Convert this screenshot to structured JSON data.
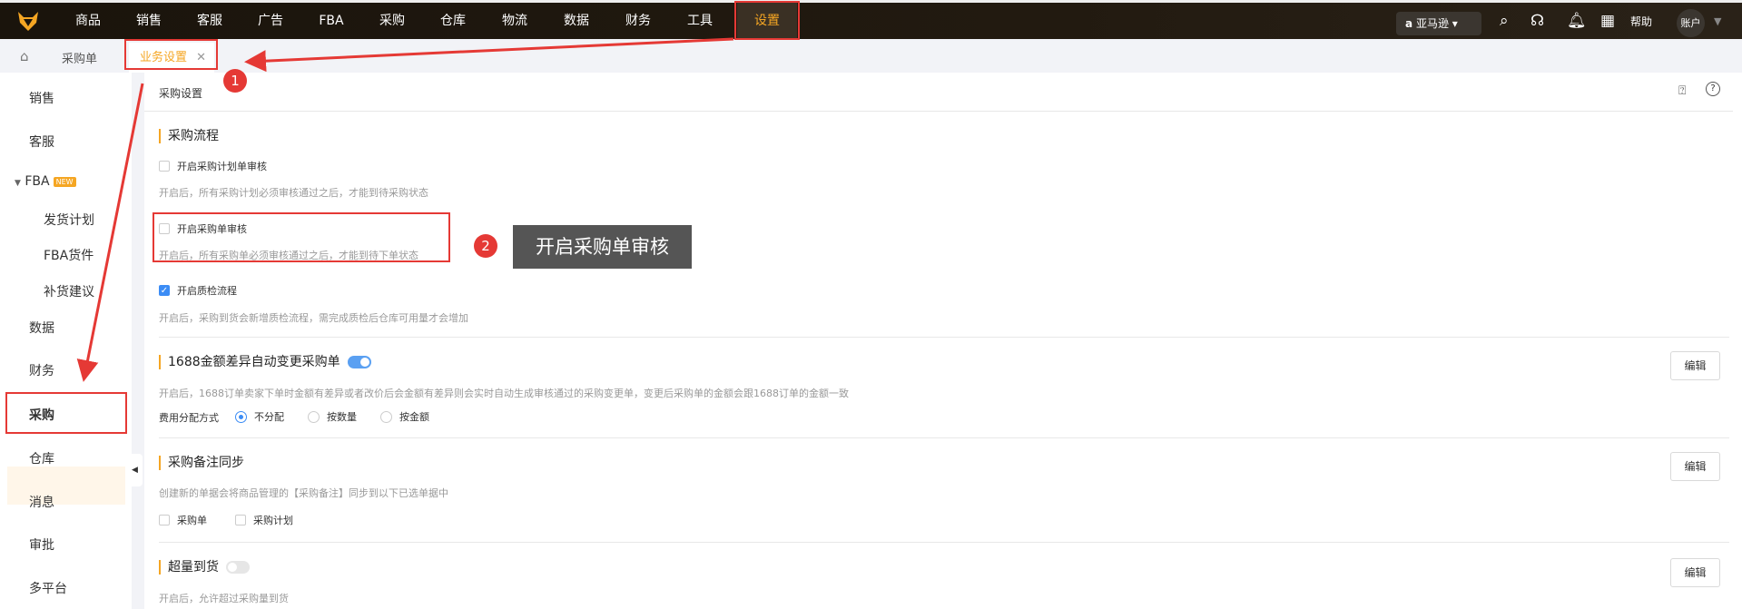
{
  "topnav": {
    "items": [
      "商品",
      "销售",
      "客服",
      "广告",
      "FBA",
      "采购",
      "仓库",
      "物流",
      "数据",
      "财务",
      "工具",
      "设置"
    ],
    "active": "设置",
    "marketplace": "亚马逊",
    "help": "帮助",
    "account": "账户"
  },
  "tabbar": {
    "breadcrumb": "采购单",
    "active_tab": "业务设置"
  },
  "sidebar": {
    "items": [
      "销售",
      "客服",
      "FBA",
      "发货计划",
      "FBA货件",
      "补货建议",
      "数据",
      "财务",
      "采购",
      "仓库",
      "消息",
      "审批",
      "多平台"
    ],
    "fba_badge": "NEW"
  },
  "main": {
    "header": "采购设置",
    "flow": {
      "title": "采购流程",
      "options": [
        {
          "label": "开启采购计划单审核",
          "desc": "开启后，所有采购计划必须审核通过之后，才能到待采购状态",
          "checked": false
        },
        {
          "label": "开启采购单审核",
          "desc": "开启后，所有采购单必须审核通过之后，才能到待下单状态",
          "checked": false
        },
        {
          "label": "开启质检流程",
          "desc": "开启后，采购到货会新增质检流程，需完成质检后仓库可用量才会增加",
          "checked": true
        }
      ]
    },
    "diff": {
      "title": "1688金额差异自动变更采购单",
      "enabled": true,
      "desc": "开启后，1688订单卖家下单时金额有差异或者改价后会金额有差异则会实时自动生成审核通过的采购变更单，变更后采购单的金额会跟1688订单的金额一致",
      "fee_label": "费用分配方式",
      "fee_options": [
        "不分配",
        "按数量",
        "按金额"
      ],
      "fee_selected": "不分配",
      "edit": "编辑"
    },
    "remark": {
      "title": "采购备注同步",
      "desc": "创建新的单据会将商品管理的【采购备注】同步到以下已选单据中",
      "options": [
        "采购单",
        "采购计划"
      ],
      "edit": "编辑"
    },
    "over": {
      "title": "超量到货",
      "enabled": false,
      "desc": "开启后，允许超过采购量到货",
      "edit": "编辑"
    }
  },
  "annotations": {
    "step1": "1",
    "step2": "2",
    "tooltip": "开启采购单审核"
  }
}
